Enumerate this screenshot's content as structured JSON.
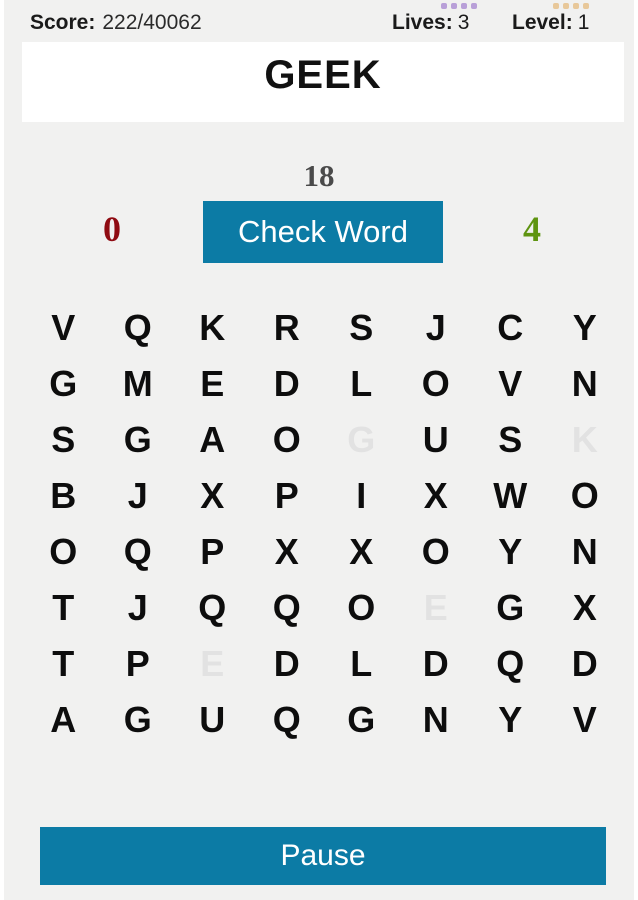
{
  "statusbar": {
    "score_label": "Score:",
    "score_value": "222/40062",
    "lives_label": "Lives:",
    "lives_value": "3",
    "level_label": "Level:",
    "level_value": "1",
    "lives_dot_color": "#b9a0d8",
    "level_dot_color": "#e8c89a",
    "lives_dot_count": 4,
    "level_dot_count": 4
  },
  "word_card": {
    "word": "GEEK"
  },
  "counters": {
    "timer": "18",
    "wrong": "0",
    "wrong_color": "#8f0b12",
    "found": "4",
    "found_color": "#5e9410"
  },
  "buttons": {
    "check_word": "Check Word",
    "pause": "Pause",
    "accent_color": "#0c7ba5"
  },
  "grid": {
    "rows": 8,
    "cols": 8,
    "faded_color": "#e2e2e2",
    "cells": [
      {
        "letter": "V",
        "faded": false
      },
      {
        "letter": "Q",
        "faded": false
      },
      {
        "letter": "K",
        "faded": false
      },
      {
        "letter": "R",
        "faded": false
      },
      {
        "letter": "S",
        "faded": false
      },
      {
        "letter": "J",
        "faded": false
      },
      {
        "letter": "C",
        "faded": false
      },
      {
        "letter": "Y",
        "faded": false
      },
      {
        "letter": "G",
        "faded": false
      },
      {
        "letter": "M",
        "faded": false
      },
      {
        "letter": "E",
        "faded": false
      },
      {
        "letter": "D",
        "faded": false
      },
      {
        "letter": "L",
        "faded": false
      },
      {
        "letter": "O",
        "faded": false
      },
      {
        "letter": "V",
        "faded": false
      },
      {
        "letter": "N",
        "faded": false
      },
      {
        "letter": "S",
        "faded": false
      },
      {
        "letter": "G",
        "faded": false
      },
      {
        "letter": "A",
        "faded": false
      },
      {
        "letter": "O",
        "faded": false
      },
      {
        "letter": "G",
        "faded": true
      },
      {
        "letter": "U",
        "faded": false
      },
      {
        "letter": "S",
        "faded": false
      },
      {
        "letter": "K",
        "faded": true
      },
      {
        "letter": "B",
        "faded": false
      },
      {
        "letter": "J",
        "faded": false
      },
      {
        "letter": "X",
        "faded": false
      },
      {
        "letter": "P",
        "faded": false
      },
      {
        "letter": "I",
        "faded": false
      },
      {
        "letter": "X",
        "faded": false
      },
      {
        "letter": "W",
        "faded": false
      },
      {
        "letter": "O",
        "faded": false
      },
      {
        "letter": "O",
        "faded": false
      },
      {
        "letter": "Q",
        "faded": false
      },
      {
        "letter": "P",
        "faded": false
      },
      {
        "letter": "X",
        "faded": false
      },
      {
        "letter": "X",
        "faded": false
      },
      {
        "letter": "O",
        "faded": false
      },
      {
        "letter": "Y",
        "faded": false
      },
      {
        "letter": "N",
        "faded": false
      },
      {
        "letter": "T",
        "faded": false
      },
      {
        "letter": "J",
        "faded": false
      },
      {
        "letter": "Q",
        "faded": false
      },
      {
        "letter": "Q",
        "faded": false
      },
      {
        "letter": "O",
        "faded": false
      },
      {
        "letter": "E",
        "faded": true
      },
      {
        "letter": "G",
        "faded": false
      },
      {
        "letter": "X",
        "faded": false
      },
      {
        "letter": "T",
        "faded": false
      },
      {
        "letter": "P",
        "faded": false
      },
      {
        "letter": "E",
        "faded": true
      },
      {
        "letter": "D",
        "faded": false
      },
      {
        "letter": "L",
        "faded": false
      },
      {
        "letter": "D",
        "faded": false
      },
      {
        "letter": "Q",
        "faded": false
      },
      {
        "letter": "D",
        "faded": false
      },
      {
        "letter": "A",
        "faded": false
      },
      {
        "letter": "G",
        "faded": false
      },
      {
        "letter": "U",
        "faded": false
      },
      {
        "letter": "Q",
        "faded": false
      },
      {
        "letter": "G",
        "faded": false
      },
      {
        "letter": "N",
        "faded": false
      },
      {
        "letter": "Y",
        "faded": false
      },
      {
        "letter": "V",
        "faded": false
      }
    ]
  }
}
